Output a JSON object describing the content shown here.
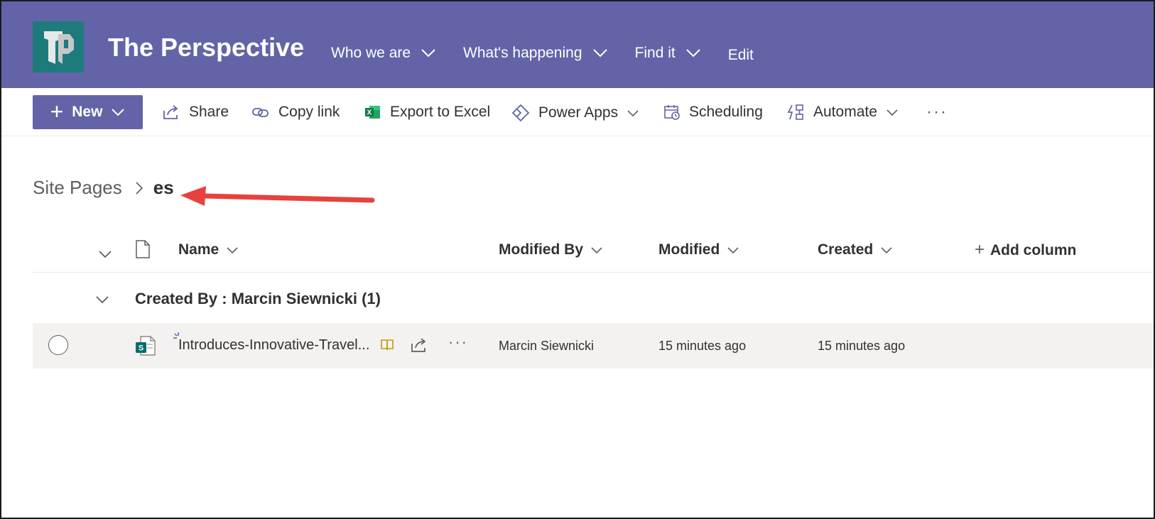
{
  "header": {
    "site_title": "The Perspective",
    "nav": [
      {
        "label": "Who we are"
      },
      {
        "label": "What's happening"
      },
      {
        "label": "Find it"
      }
    ],
    "edit_label": "Edit"
  },
  "commands": {
    "new_label": "New",
    "share_label": "Share",
    "copy_link_label": "Copy link",
    "export_label": "Export to Excel",
    "power_apps_label": "Power Apps",
    "scheduling_label": "Scheduling",
    "automate_label": "Automate",
    "more_label": "···"
  },
  "breadcrumb": {
    "root": "Site Pages",
    "current": "es"
  },
  "columns": {
    "name": "Name",
    "modified_by": "Modified By",
    "modified": "Modified",
    "created": "Created",
    "add_column": "Add column"
  },
  "group": {
    "title": "Created By : Marcin Siewnicki (1)"
  },
  "rows": [
    {
      "name": "Introduces-Innovative-Travel...",
      "modified_by": "Marcin Siewnicki",
      "modified": "15 minutes ago",
      "created": "15 minutes ago",
      "more": "···"
    }
  ],
  "colors": {
    "brand": "#6264a7",
    "logo_bg": "#1e7b7c",
    "arrow": "#e8413d",
    "row_bg": "#f3f2f1"
  }
}
